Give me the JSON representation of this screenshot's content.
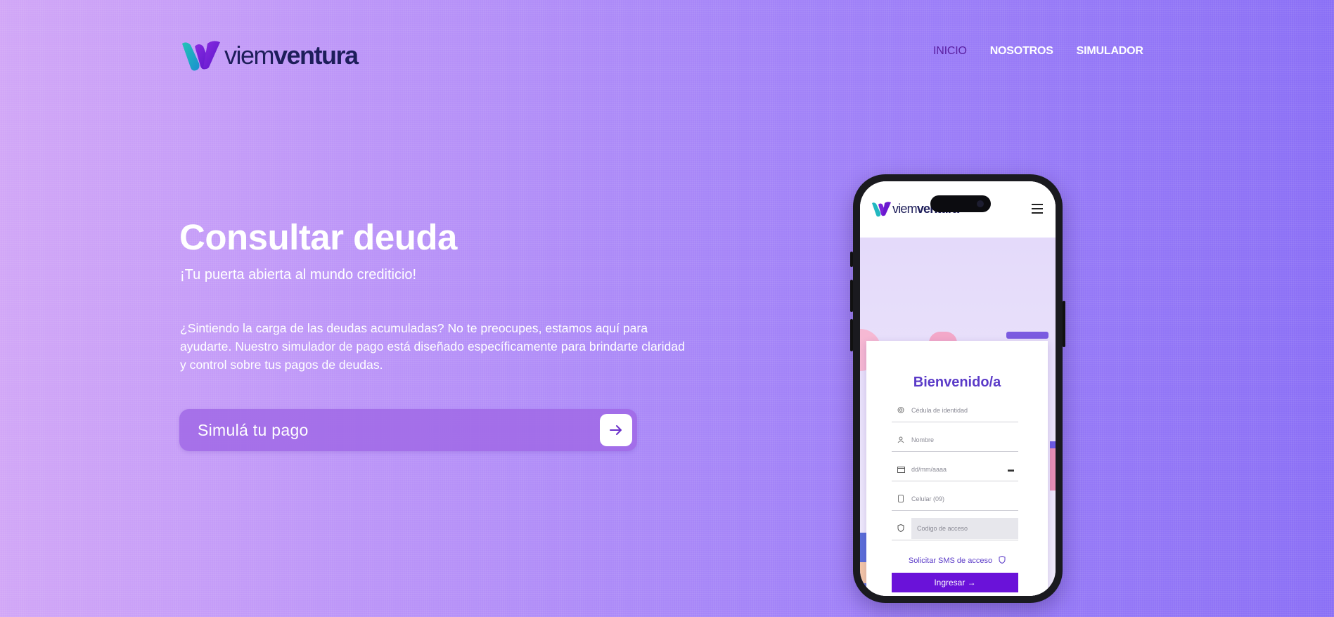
{
  "brand": {
    "name_light": "viem",
    "name_bold": "ventura"
  },
  "nav": {
    "items": [
      {
        "label": "INICIO",
        "active": true
      },
      {
        "label": "NOSOTROS",
        "active": false
      },
      {
        "label": "SIMULADOR",
        "active": false
      }
    ]
  },
  "hero": {
    "title": "Consultar deuda",
    "subtitle": "¡Tu puerta abierta al mundo crediticio!",
    "description": "¿Sintiendo la carga de las deudas acumuladas? No te preocupes, estamos aquí para ayudarte. Nuestro simulador de pago está diseñado específicamente para brindarte claridad y control sobre tus pagos de deudas.",
    "cta_label": "Simulá tu pago",
    "cta_icon": "arrow-right-icon"
  },
  "phone": {
    "card_title": "Bienvenido/a",
    "fields": [
      {
        "placeholder": "Cédula de identidad",
        "icon": "fingerprint-icon"
      },
      {
        "placeholder": "Nombre",
        "icon": "user-icon"
      },
      {
        "placeholder": "dd/mm/aaaa",
        "icon": "calendar-icon"
      },
      {
        "placeholder": "Celular (09)",
        "icon": "mobile-icon"
      },
      {
        "placeholder": "Codigo de acceso",
        "icon": "shield-icon"
      }
    ],
    "sms_link": "Solicitar SMS de acceso",
    "submit_label": "Ingresar →"
  },
  "colors": {
    "accent": "#6a12d9",
    "nav_active": "#5a1fa0",
    "card_title": "#5b3bc8"
  }
}
